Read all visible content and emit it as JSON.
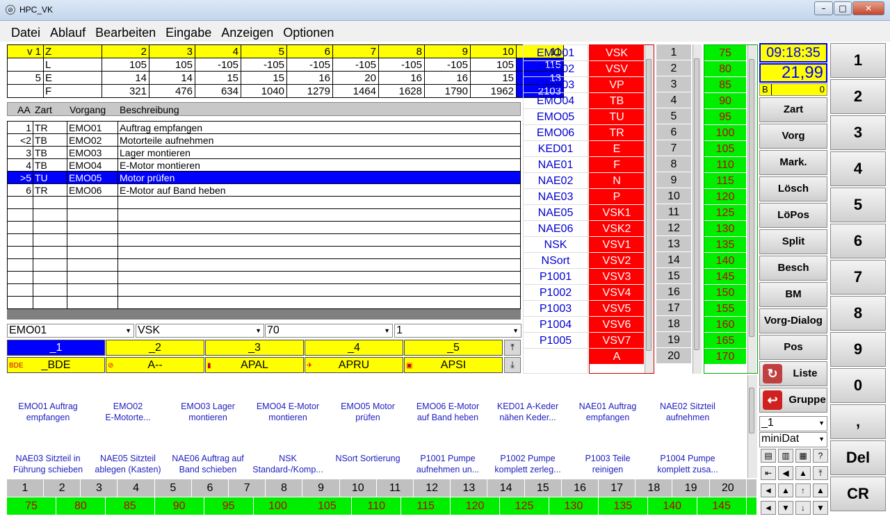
{
  "window": {
    "title": "HPC_VK",
    "min": "–",
    "max": "□",
    "close": "✕"
  },
  "menu": [
    "Datei",
    "Ablauf",
    "Bearbeiten",
    "Eingabe",
    "Anzeigen",
    "Optionen"
  ],
  "fields": {
    "header": [
      "v 1",
      "Z",
      "2",
      "3",
      "4",
      "5",
      "6",
      "7",
      "8",
      "9",
      "10",
      "11"
    ],
    "rows": [
      [
        "",
        "L",
        "105",
        "105",
        "-105",
        "-105",
        "-105",
        "-105",
        "-105",
        "-105",
        "105",
        "115"
      ],
      [
        "5",
        "E",
        "14",
        "14",
        "15",
        "15",
        "16",
        "20",
        "16",
        "16",
        "15",
        "13"
      ],
      [
        "",
        "F",
        "321",
        "476",
        "634",
        "1040",
        "1279",
        "1464",
        "1628",
        "1790",
        "1962",
        "2103"
      ]
    ]
  },
  "vorgang": {
    "columns": [
      "AA",
      "Zart",
      "Vorgang",
      "Beschreibung"
    ],
    "rows": [
      [
        "1",
        "TR",
        "EMO01",
        "Auftrag empfangen"
      ],
      [
        "<2",
        "TB",
        "EMO02",
        "Motorteile aufnehmen"
      ],
      [
        "3",
        "TB",
        "EMO03",
        "Lager montieren"
      ],
      [
        "4",
        "TB",
        "EMO04",
        "E-Motor montieren"
      ],
      [
        ">5",
        "TU",
        "EMO05",
        "Motor prüfen"
      ],
      [
        "6",
        "TR",
        "EMO06",
        "E-Motor auf Band heben"
      ]
    ],
    "selected_index": 4
  },
  "combos": [
    "EMO01",
    "VSK",
    "70",
    "1"
  ],
  "tabs": [
    "_1",
    "_2",
    "_3",
    "_4",
    "_5"
  ],
  "tabs2": [
    {
      "icon": "BDE",
      "label": "_BDE"
    },
    {
      "icon": "⊘",
      "label": "A--"
    },
    {
      "icon": "▮",
      "label": "APAL"
    },
    {
      "icon": "✈",
      "label": "APRU"
    },
    {
      "icon": "▣",
      "label": "APSI"
    }
  ],
  "names": [
    "EMO01",
    "EMO02",
    "EMO03",
    "EMO04",
    "EMO05",
    "EMO06",
    "KED01",
    "NAE01",
    "NAE02",
    "NAE03",
    "NAE05",
    "NAE06",
    "NSK",
    "NSort",
    "P1001",
    "P1002",
    "P1003",
    "P1004",
    "P1005"
  ],
  "codes": [
    "VSK",
    "VSV",
    "VP",
    "TB",
    "TU",
    "TR",
    "E",
    "F",
    "N",
    "P",
    "VSK1",
    "VSK2",
    "VSV1",
    "VSV2",
    "VSV3",
    "VSV4",
    "VSV5",
    "VSV6",
    "VSV7",
    "A"
  ],
  "nums": [
    "1",
    "2",
    "3",
    "4",
    "5",
    "6",
    "7",
    "8",
    "9",
    "10",
    "11",
    "12",
    "13",
    "14",
    "15",
    "16",
    "17",
    "18",
    "19",
    "20"
  ],
  "vals": [
    "75",
    "80",
    "85",
    "90",
    "95",
    "100",
    "105",
    "110",
    "115",
    "120",
    "125",
    "130",
    "135",
    "140",
    "145",
    "150",
    "155",
    "160",
    "165",
    "170"
  ],
  "status": {
    "time": "09:18:35",
    "value": "21,99",
    "b_label": "B",
    "b_value": "0"
  },
  "side_buttons": [
    "Zart",
    "Vorg",
    "Mark.",
    "Lösch",
    "LöPos",
    "Split",
    "Besch",
    "BM",
    "Vorg-Dialog",
    "Pos"
  ],
  "side_icons": [
    {
      "label": "Liste"
    },
    {
      "label": "Gruppe"
    }
  ],
  "side_combos": [
    "_1",
    "miniDat"
  ],
  "keypad": [
    "1",
    "2",
    "3",
    "4",
    "5",
    "6",
    "7",
    "8",
    "9",
    "0",
    ",",
    "Del",
    "CR"
  ],
  "tiles": [
    [
      "EMO01 Auftrag",
      "empfangen"
    ],
    [
      "EMO02",
      "E-Motorte..."
    ],
    [
      "EMO03 Lager",
      "montieren"
    ],
    [
      "EMO04 E-Motor",
      "montieren"
    ],
    [
      "EMO05 Motor",
      "prüfen"
    ],
    [
      "EMO06 E-Motor",
      "auf Band heben"
    ],
    [
      "KED01 A-Keder",
      "nähen Keder..."
    ],
    [
      "NAE01 Auftrag",
      "empfangen"
    ],
    [
      "NAE02 Sitzteil",
      "aufnehmen"
    ],
    [
      "NAE03 Sitzteil in",
      "Führung schieben"
    ],
    [
      "NAE05 Sitzteil",
      "ablegen (Kasten)"
    ],
    [
      "NAE06 Auftrag auf",
      "Band schieben"
    ],
    [
      "NSK",
      "Standard-/Komp..."
    ],
    [
      "NSort Sortierung",
      ""
    ],
    [
      "P1001 Pumpe",
      "aufnehmen un..."
    ],
    [
      "P1002 Pumpe",
      "komplett zerleg..."
    ],
    [
      "P1003 Teile",
      "reinigen"
    ],
    [
      "P1004 Pumpe",
      "komplett zusa..."
    ]
  ],
  "bottom_nums": [
    "1",
    "2",
    "3",
    "4",
    "5",
    "6",
    "7",
    "8",
    "9",
    "10",
    "11",
    "12",
    "13",
    "14",
    "15",
    "16",
    "17",
    "18",
    "19",
    "20"
  ],
  "bottom_vals": [
    "75",
    "80",
    "85",
    "90",
    "95",
    "100",
    "105",
    "110",
    "115",
    "120",
    "125",
    "130",
    "135",
    "140",
    "145"
  ],
  "tool_icons": [
    "▤",
    "▥",
    "▦",
    "?",
    "⇤",
    "◀",
    "▲",
    "⤒",
    "◄",
    "▲",
    "↑",
    "▲",
    "◄",
    "▼",
    "↓",
    "▼"
  ],
  "colors": {
    "yellow": "#ffff00",
    "blue": "#0000ff",
    "red": "#ff0000",
    "green": "#00ee00"
  }
}
